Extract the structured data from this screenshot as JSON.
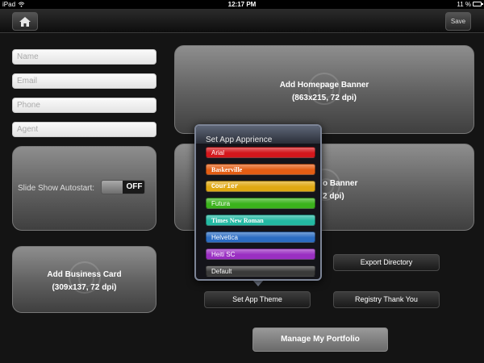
{
  "status_bar": {
    "carrier": "iPad",
    "time": "12:17 PM",
    "battery": "11 %"
  },
  "toolbar": {
    "save_label": "Save"
  },
  "form": {
    "name_placeholder": "Name",
    "email_placeholder": "Email",
    "phone_placeholder": "Phone",
    "agent_placeholder": "Agent"
  },
  "slideshow": {
    "label": "Slide Show Autostart:",
    "toggle_value": "OFF"
  },
  "business_card": {
    "title": "Add Business Card",
    "subtitle": "(309x137, 72 dpi)"
  },
  "homepage_banner": {
    "title": "Add Homepage Banner",
    "subtitle": "(863x215, 72 dpi)"
  },
  "second_banner": {
    "title_visible": "o Banner",
    "subtitle_visible": "2 dpi)"
  },
  "buttons": {
    "set_theme": "Set App Theme",
    "export_directory": "Export Directory",
    "registry_thank_you": "Registry Thank You",
    "manage_portfolio": "Manage My Portfolio"
  },
  "popover": {
    "title": "Set App Apprience",
    "options": [
      {
        "label": "Arial",
        "color": "#d4171c"
      },
      {
        "label": "Baskerville",
        "color": "#e35d14"
      },
      {
        "label": "Courier",
        "color": "#e0a812"
      },
      {
        "label": "Futura",
        "color": "#3bb21c"
      },
      {
        "label": "Times New Roman",
        "color": "#23b9a3"
      },
      {
        "label": "Helvetica",
        "color": "#2b6cc2"
      },
      {
        "label": "Heiti SC",
        "color": "#9a2fc2"
      },
      {
        "label": "Default",
        "color": "#3a3a3a"
      }
    ]
  }
}
